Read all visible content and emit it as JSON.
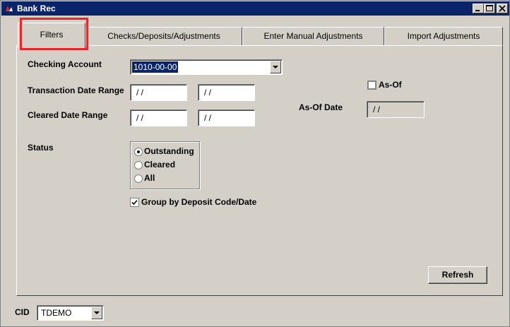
{
  "window": {
    "title": "Bank Rec"
  },
  "tabs": [
    {
      "label": "Filters",
      "active": true
    },
    {
      "label": "Checks/Deposits/Adjustments",
      "active": false
    },
    {
      "label": "Enter Manual Adjustments",
      "active": false
    },
    {
      "label": "Import Adjustments",
      "active": false
    }
  ],
  "filters": {
    "checking_account_label": "Checking Account",
    "checking_account_value": "1010-00-00",
    "transaction_date_range_label": "Transaction Date Range",
    "transaction_date_from": "/ /",
    "transaction_date_to": "/ /",
    "cleared_date_range_label": "Cleared Date Range",
    "cleared_date_from": "/ /",
    "cleared_date_to": "/ /",
    "as_of_label": "As-Of",
    "as_of_checked": false,
    "as_of_date_label": "As-Of Date",
    "as_of_date_value": "/ /",
    "status_label": "Status",
    "status_options": [
      "Outstanding",
      "Cleared",
      "All"
    ],
    "status_selected": "Outstanding",
    "group_by_label": "Group by Deposit Code/Date",
    "group_by_checked": true,
    "refresh_label": "Refresh"
  },
  "footer": {
    "cid_label": "CID",
    "cid_value": "TDEMO"
  },
  "colors": {
    "titlebar": "#0a246a",
    "window_bg": "#d4d0c8",
    "highlight": "#e8262b",
    "selection": "#0a246a"
  }
}
